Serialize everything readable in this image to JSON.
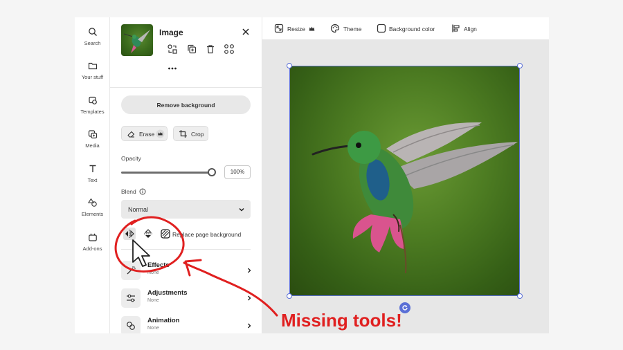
{
  "rail": {
    "items": [
      {
        "label": "Search",
        "icon": "search-icon"
      },
      {
        "label": "Your stuff",
        "icon": "folder-icon"
      },
      {
        "label": "Templates",
        "icon": "templates-icon"
      },
      {
        "label": "Media",
        "icon": "media-icon"
      },
      {
        "label": "Text",
        "icon": "text-icon"
      },
      {
        "label": "Elements",
        "icon": "elements-icon"
      },
      {
        "label": "Add-ons",
        "icon": "addons-icon"
      }
    ]
  },
  "panel": {
    "title": "Image",
    "remove_background": "Remove background",
    "erase_label": "Erase",
    "crop_label": "Crop",
    "opacity_label": "Opacity",
    "opacity_value": "100%",
    "opacity_level": 1.0,
    "blend_label": "Blend",
    "blend_value": "Normal",
    "replace_page_bg": "Replace page background",
    "rows": [
      {
        "title": "Effects",
        "sub": "None"
      },
      {
        "title": "Adjustments",
        "sub": "None"
      },
      {
        "title": "Animation",
        "sub": "None"
      }
    ]
  },
  "toolbar": {
    "resize": "Resize",
    "theme": "Theme",
    "background_color": "Background color",
    "align": "Align"
  },
  "annotation": {
    "callout": "Missing tools!",
    "color": "#e02020"
  },
  "colors": {
    "selection": "#5a6fd6"
  }
}
